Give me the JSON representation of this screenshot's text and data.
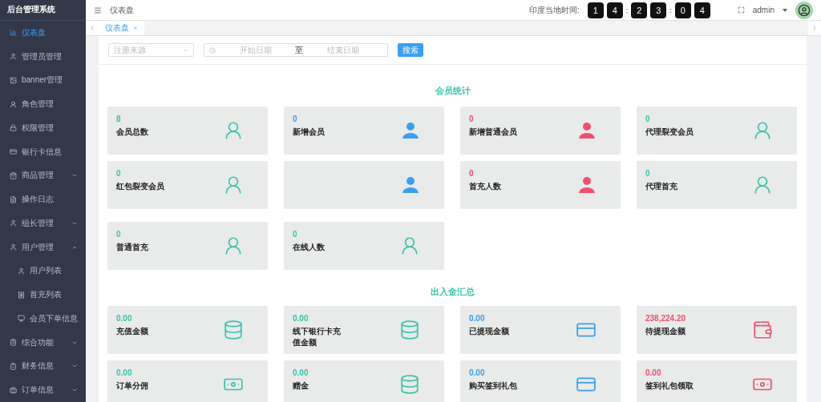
{
  "sidebar": {
    "title": "后台管理系统",
    "items": [
      {
        "label": "仪表盘",
        "selected": true
      },
      {
        "label": "管理员管理",
        "selected": false
      },
      {
        "label": "banner管理",
        "selected": false
      },
      {
        "label": "角色管理",
        "selected": false
      },
      {
        "label": "权限管理",
        "selected": false
      },
      {
        "label": "银行卡信息",
        "selected": false
      },
      {
        "label": "商品管理",
        "selected": false,
        "expanded": false
      },
      {
        "label": "操作日志",
        "selected": false
      },
      {
        "label": "组长管理",
        "selected": false,
        "expanded": false
      },
      {
        "label": "用户管理",
        "selected": false,
        "expanded": true,
        "children": [
          {
            "label": "用户列表",
            "selected": false
          },
          {
            "label": "首充列表",
            "selected": false
          },
          {
            "label": "会员下单信息",
            "selected": false
          }
        ]
      },
      {
        "label": "综合功能",
        "selected": false,
        "expanded": false
      },
      {
        "label": "财务信息",
        "selected": false,
        "expanded": false
      },
      {
        "label": "订单信息",
        "selected": false,
        "expanded": false
      }
    ]
  },
  "header": {
    "breadcrumb": "仪表盘",
    "clock_label": "印度当地时间:",
    "clock_digits": [
      "1",
      "4",
      "2",
      "3",
      "0",
      "4"
    ],
    "clock_separator": ":",
    "user": "admin"
  },
  "tabs": [
    {
      "label": "仪表盘",
      "selected": true
    }
  ],
  "filters": {
    "source": {
      "placeholder": "注册来源"
    },
    "start": {
      "placeholder": "开始日期"
    },
    "separator": "至",
    "end": {
      "placeholder": "结束日期"
    },
    "button": "搜索"
  },
  "sections": [
    {
      "title": "会员统计",
      "rows": [
        [
          {
            "kind": "person-outline",
            "value": "8",
            "label": "会员总数",
            "color": "#3cc3ad"
          },
          {
            "kind": "person-solid",
            "value": "0",
            "label": "新增会员",
            "color": "#3a9ff0"
          },
          {
            "kind": "person-solid",
            "value": "0",
            "label": "新增普通会员",
            "color": "#f0506e"
          },
          {
            "kind": "person-outline",
            "value": "0",
            "label": "代理裂变会员",
            "color": "#3cc3ad"
          }
        ],
        [
          {
            "kind": "person-outline",
            "value": "0",
            "label": "红包裂变会员",
            "color": "#3cc3ad"
          },
          {
            "kind": "person-solid",
            "color": "#3a9ff0"
          },
          {
            "kind": "person-solid",
            "value": "0",
            "label": "首充人数",
            "color": "#f0506e"
          },
          {
            "kind": "person-outline",
            "value": "0",
            "label": "代理首充",
            "color": "#3cc3ad"
          }
        ],
        [
          {
            "kind": "person-outline",
            "value": "0",
            "label": "普通首充",
            "color": "#3cc3ad"
          },
          {
            "kind": "person-outline",
            "value": "0",
            "label": "在线人数",
            "color": "#3cc3ad"
          }
        ]
      ]
    },
    {
      "title": "出入金汇总",
      "rows": [
        [
          {
            "kind": "coins",
            "value": "0.00",
            "label": "充值金额",
            "color": "#3cc3ad"
          },
          {
            "kind": "coins",
            "value": "0.00",
            "label": "线下银行卡充值金额",
            "color": "#3cc3ad"
          },
          {
            "kind": "card",
            "value": "0.00",
            "label": "已提现金额",
            "color": "#3a9ff0"
          },
          {
            "kind": "wallet",
            "value": "238,224.20",
            "label": "待提现金额",
            "color": "#f0506e"
          }
        ],
        [
          {
            "kind": "cash",
            "value": "0.00",
            "label": "订单分佣",
            "color": "#3cc3ad"
          },
          {
            "kind": "coins",
            "value": "0.00",
            "label": "赠金",
            "color": "#3cc3ad"
          },
          {
            "kind": "card",
            "value": "0.00",
            "label": "购买签到礼包",
            "color": "#3a9ff0"
          },
          {
            "kind": "cash",
            "value": "0.00",
            "label": "签到礼包领取",
            "color": "#f0506e"
          }
        ]
      ]
    }
  ]
}
